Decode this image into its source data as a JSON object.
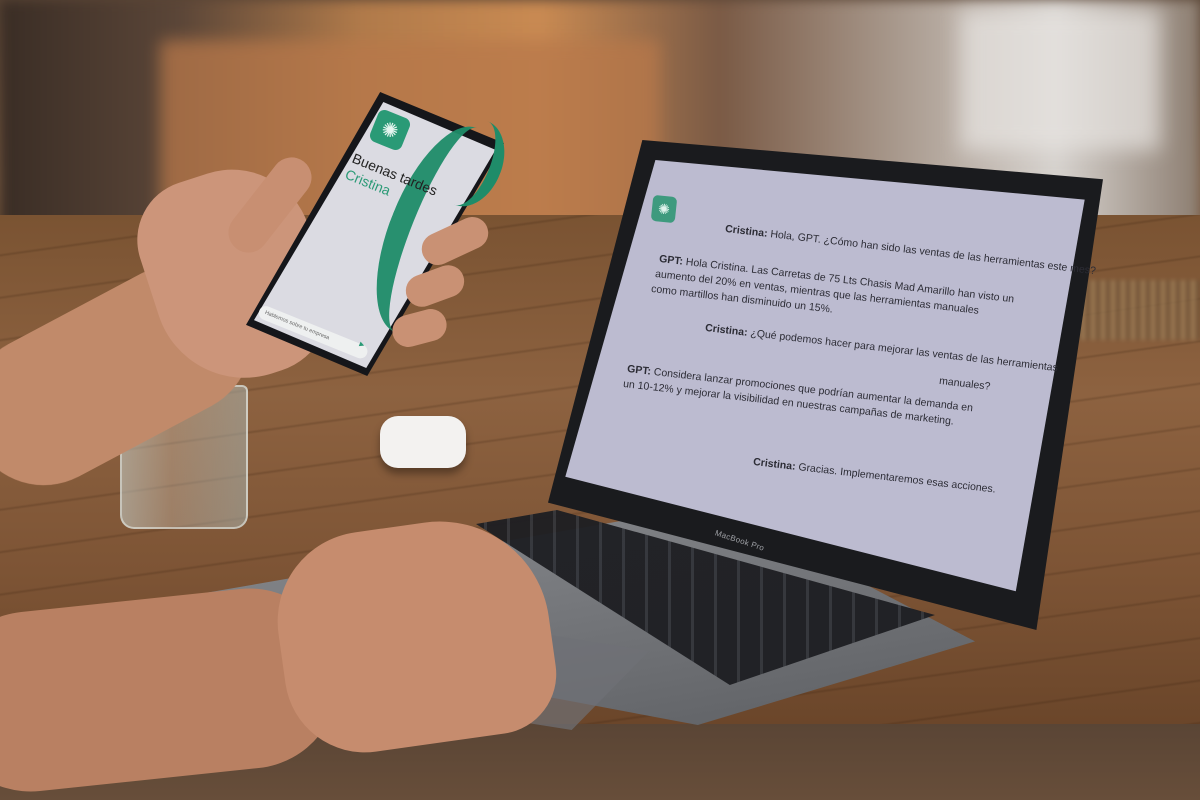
{
  "phone_app": {
    "greeting": "Buenas tardes",
    "user_name": "Cristina",
    "input_placeholder": "Hablemos sobre tu empresa",
    "accent_color": "#2a9a76"
  },
  "laptop": {
    "brand": "MacBook Pro",
    "messages": [
      {
        "speaker": "Cristina:",
        "text": " Hola, GPT. ¿Cómo han sido las ventas de las herramientas este mes?"
      },
      {
        "speaker": "GPT:",
        "text": " Hola Cristina. Las Carretas de 75 Lts Chasis Mad Amarillo han visto un"
      },
      {
        "speaker": "",
        "text": "aumento del 20% en ventas, mientras que las herramientas manuales"
      },
      {
        "speaker": "",
        "text": "como martillos han disminuido un 15%."
      },
      {
        "speaker": "Cristina:",
        "text": " ¿Qué podemos hacer para mejorar las ventas de las herramientas"
      },
      {
        "speaker": "",
        "text": "manuales?"
      },
      {
        "speaker": "GPT:",
        "text": " Considera lanzar promociones que podrían aumentar la demanda en"
      },
      {
        "speaker": "",
        "text": "un 10-12% y mejorar la visibilidad en nuestras campañas de marketing."
      },
      {
        "speaker": "Cristina:",
        "text": "  Gracias. Implementaremos esas acciones."
      }
    ]
  },
  "icons": {
    "app_logo": "openai-logo-icon",
    "send": "send-icon"
  }
}
